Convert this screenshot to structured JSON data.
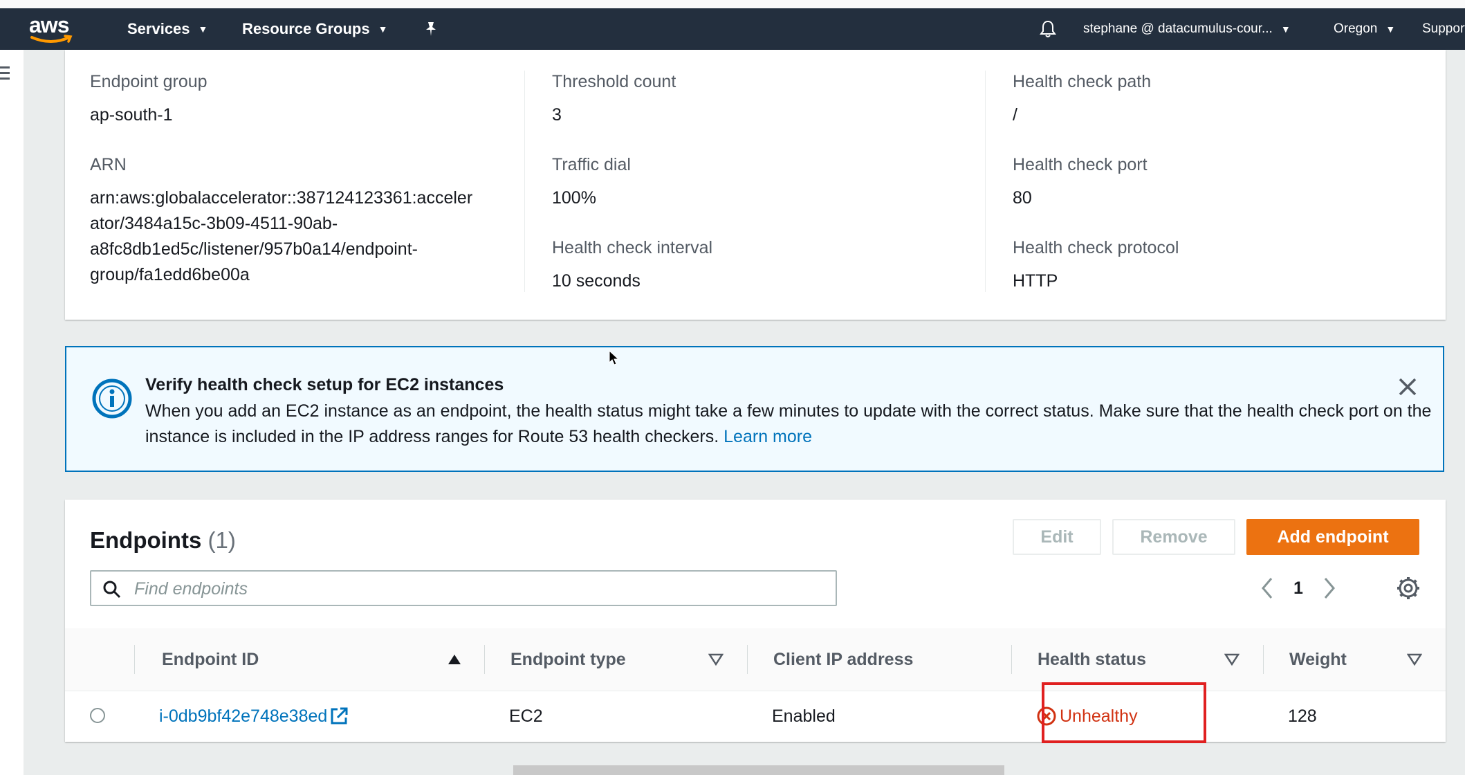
{
  "navbar": {
    "logo_text": "aws",
    "services": "Services",
    "resource_groups": "Resource Groups",
    "account": "stephane @ datacumulus-cour...",
    "region": "Oregon",
    "support": "Support",
    "icons": [
      "bell-icon",
      "pin-icon",
      "chevron-down-icon"
    ]
  },
  "details": {
    "col1": [
      {
        "label": "Endpoint group",
        "value": "ap-south-1"
      },
      {
        "label": "ARN",
        "value_lines": [
          "arn:aws:globalaccelerator::387124123361:acceler",
          "ator/3484a15c-3b09-4511-90ab-",
          "a8fc8db1ed5c/listener/957b0a14/endpoint-",
          "group/fa1edd6be00a"
        ]
      }
    ],
    "col2": [
      {
        "label": "Threshold count",
        "value": "3"
      },
      {
        "label": "Traffic dial",
        "value": "100%"
      },
      {
        "label": "Health check interval",
        "value": "10 seconds"
      }
    ],
    "col3": [
      {
        "label": "Health check path",
        "value": "/"
      },
      {
        "label": "Health check port",
        "value": "80"
      },
      {
        "label": "Health check protocol",
        "value": "HTTP"
      }
    ]
  },
  "alert": {
    "title": "Verify health check setup for EC2 instances",
    "body": "When you add an EC2 instance as an endpoint, the health status might take a few minutes to update with the correct status. Make sure that the health check port on the instance is included in the IP address ranges for Route 53 health checkers.",
    "link": "Learn more",
    "color": "#0073bb"
  },
  "endpoints": {
    "title": "Endpoints",
    "count": "(1)",
    "edit": "Edit",
    "remove": "Remove",
    "add": "Add endpoint",
    "search_placeholder": "Find endpoints",
    "page": "1",
    "columns": [
      "Endpoint ID",
      "Endpoint type",
      "Client IP address",
      "Health status",
      "Weight"
    ],
    "rows": [
      {
        "id": "i-0db9bf42e748e38ed",
        "type": "EC2",
        "client_ip": "Enabled",
        "health": "Unhealthy",
        "weight": "128"
      }
    ],
    "primary_color": "#ec7211",
    "unhealthy_color": "#d13212"
  }
}
